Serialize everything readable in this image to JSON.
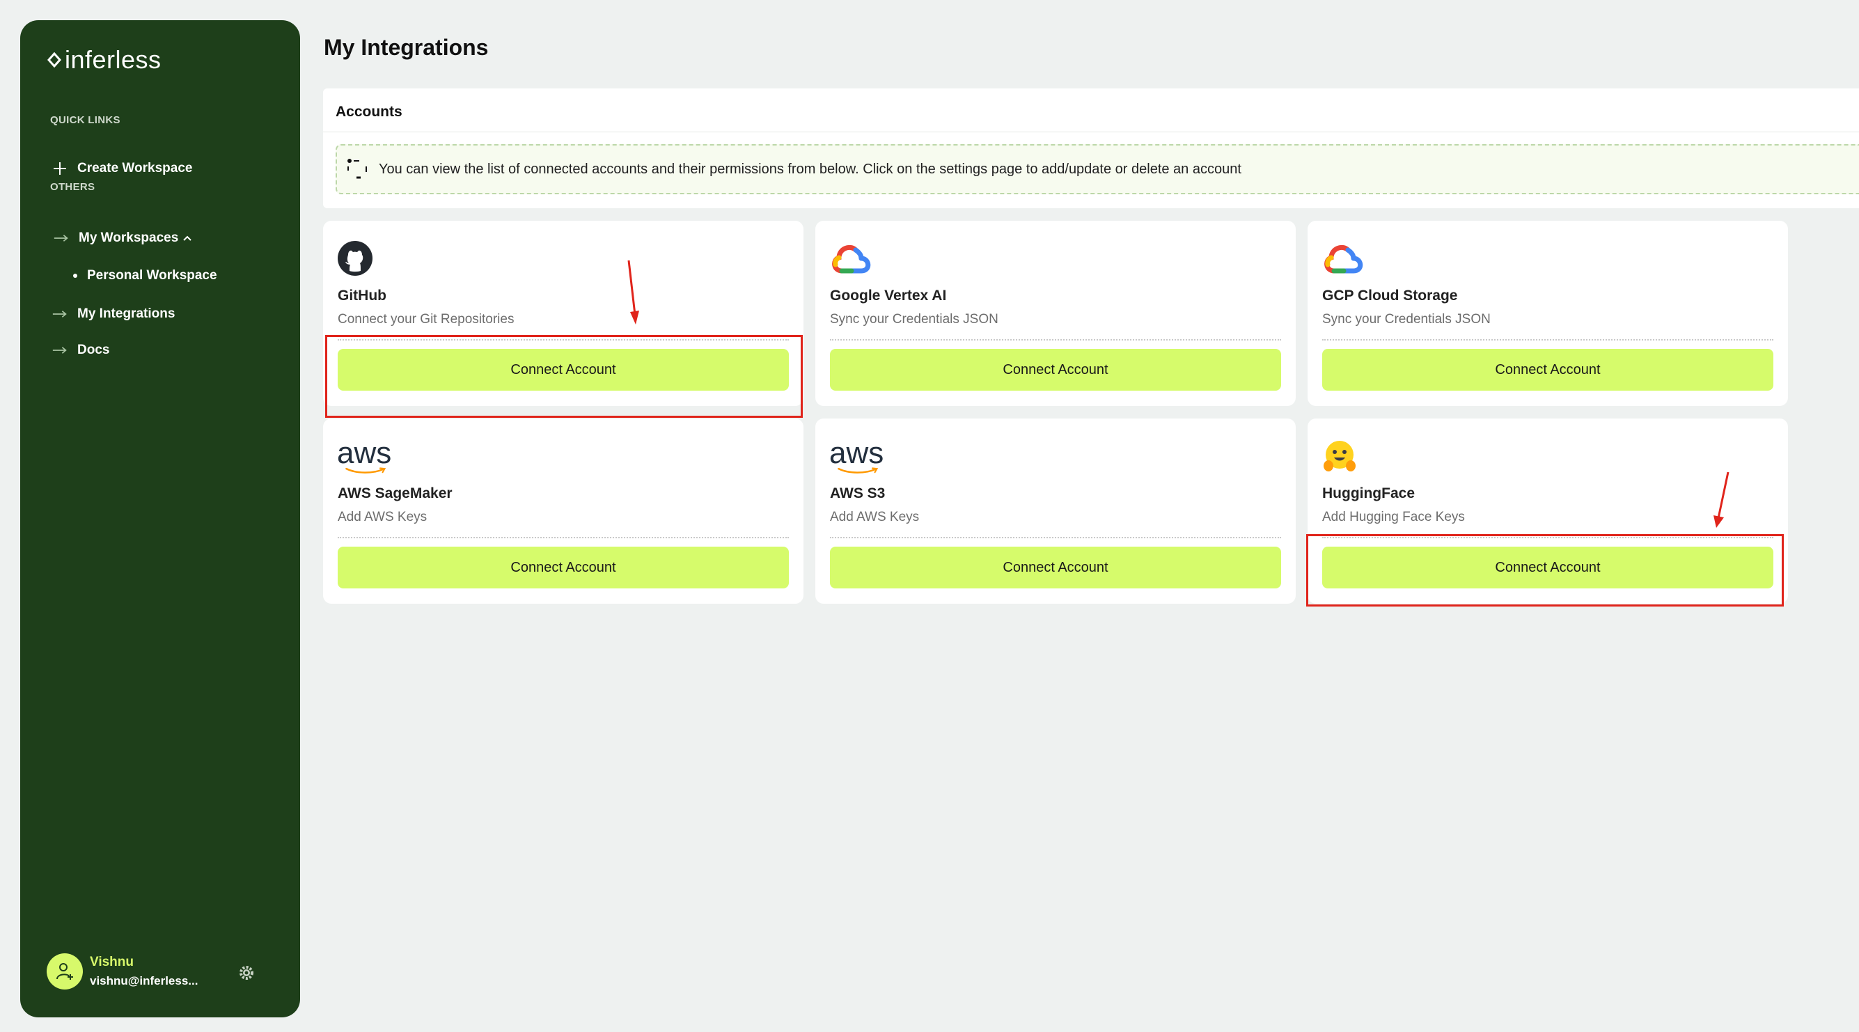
{
  "sidebar": {
    "logo_text": "inferless",
    "quick_links_label": "QUICK LINKS",
    "create_workspace": "Create Workspace",
    "others_label": "OTHERS",
    "my_workspaces": "My Workspaces",
    "personal_workspace": "Personal Workspace",
    "my_integrations": "My Integrations",
    "docs": "Docs",
    "user": {
      "name": "Vishnu",
      "email": "vishnu@inferless..."
    }
  },
  "main": {
    "page_title": "My Integrations",
    "accounts_title": "Accounts",
    "info_text": "You can view the list of connected accounts and their permissions from below. Click on the settings page to add/update or delete an account",
    "cards": [
      {
        "title": "GitHub",
        "subtitle": "Connect your Git Repositories",
        "button": "Connect Account",
        "icon": "github-icon"
      },
      {
        "title": "Google Vertex AI",
        "subtitle": "Sync your Credentials JSON",
        "button": "Connect Account",
        "icon": "google-cloud-icon"
      },
      {
        "title": "GCP Cloud Storage",
        "subtitle": "Sync your Credentials JSON",
        "button": "Connect Account",
        "icon": "google-cloud-icon"
      },
      {
        "title": "AWS SageMaker",
        "subtitle": "Add AWS Keys",
        "button": "Connect Account",
        "icon": "aws-logo",
        "logo_text": "aws"
      },
      {
        "title": "AWS S3",
        "subtitle": "Add AWS Keys",
        "button": "Connect Account",
        "icon": "aws-logo",
        "logo_text": "aws"
      },
      {
        "title": "HuggingFace",
        "subtitle": "Add Hugging Face Keys",
        "button": "Connect Account",
        "icon": "huggingface-icon"
      }
    ]
  },
  "colors": {
    "sidebar_bg": "#1e3f1a",
    "accent_lime": "#d6fb6b",
    "page_bg": "#eef1f0",
    "annotation_red": "#e0241b"
  }
}
